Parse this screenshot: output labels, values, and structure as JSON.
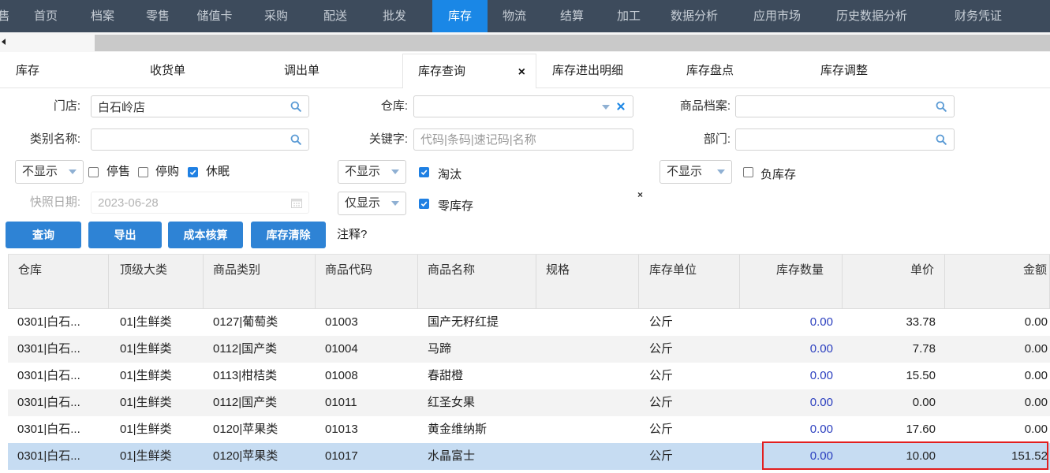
{
  "colors": {
    "nav_bg": "#3d4b5c",
    "nav_text": "#c7ced6",
    "nav_active_bg": "#1a87e6",
    "button_bg": "#2e83d5",
    "selected_row_bg": "#c6dcf2",
    "alt_row_bg": "#f3f3f3",
    "quantity_text": "#2b3fbf",
    "checkbox_checked": "#1f80e3",
    "annotation_box": "#e21f1f",
    "icon": "#5b9bd5"
  },
  "nav": {
    "items": [
      "售",
      "首页",
      "档案",
      "零售",
      "储值卡",
      "采购",
      "配送",
      "批发",
      "库存",
      "物流",
      "结算",
      "加工",
      "数据分析",
      "应用市场",
      "历史数据分析",
      "财务凭证"
    ],
    "active_index": 8
  },
  "tabs": {
    "items": [
      "库存",
      "收货单",
      "调出单",
      "库存查询",
      "库存进出明细",
      "库存盘点",
      "库存调整"
    ],
    "active_index": 3,
    "close_label": "×"
  },
  "filters": {
    "store": {
      "label": "门店:",
      "value": "白石岭店"
    },
    "warehouse": {
      "label": "仓库:"
    },
    "product_archive": {
      "label": "商品档案:"
    },
    "category": {
      "label": "类别名称:"
    },
    "keyword": {
      "label": "关键字:",
      "placeholder": "代码|条码|速记码|名称"
    },
    "department": {
      "label": "部门:"
    },
    "status_display": {
      "value": "不显示"
    },
    "stop_sale": {
      "label": "停售",
      "checked": false
    },
    "stop_purchase": {
      "label": "停购",
      "checked": false
    },
    "dormant": {
      "label": "休眠",
      "checked": true
    },
    "eliminated_display": {
      "value": "不显示"
    },
    "eliminated": {
      "label": "淘汰",
      "checked": true
    },
    "negative_display": {
      "value": "不显示"
    },
    "negative_stock": {
      "label": "负库存",
      "checked": false
    },
    "snapshot_date": {
      "label": "快照日期:",
      "value": "2023-06-28",
      "disabled": true
    },
    "zero_display": {
      "value": "仅显示"
    },
    "zero_stock": {
      "label": "零库存",
      "checked": true
    },
    "close_label": "×"
  },
  "actions": {
    "query": "查询",
    "export": "导出",
    "cost_accounting": "成本核算",
    "clear_stock": "库存清除",
    "note": "注释?"
  },
  "icons": {
    "scroll_left": "caret-left-icon",
    "search": "search-icon",
    "dropdown": "chevron-down-icon",
    "clear": "close-icon",
    "calendar": "calendar-icon",
    "checkbox": "checkbox-icon"
  },
  "table": {
    "columns": [
      "仓库",
      "顶级大类",
      "商品类别",
      "商品代码",
      "商品名称",
      "规格",
      "库存单位",
      "库存数量",
      "单价",
      "金额"
    ],
    "rows": [
      [
        "0301|白石...",
        "01|生鲜类",
        "0127|葡萄类",
        "01003",
        "国产无籽红提",
        "",
        "公斤",
        "0.00",
        "33.78",
        "0.00"
      ],
      [
        "0301|白石...",
        "01|生鲜类",
        "0112|国产类",
        "01004",
        "马蹄",
        "",
        "公斤",
        "0.00",
        "7.78",
        "0.00"
      ],
      [
        "0301|白石...",
        "01|生鲜类",
        "0113|柑桔类",
        "01008",
        "春甜橙",
        "",
        "公斤",
        "0.00",
        "15.50",
        "0.00"
      ],
      [
        "0301|白石...",
        "01|生鲜类",
        "0112|国产类",
        "01011",
        "红圣女果",
        "",
        "公斤",
        "0.00",
        "0.00",
        "0.00"
      ],
      [
        "0301|白石...",
        "01|生鲜类",
        "0120|苹果类",
        "01013",
        "黄金维纳斯",
        "",
        "公斤",
        "0.00",
        "17.60",
        "0.00"
      ],
      [
        "0301|白石...",
        "01|生鲜类",
        "0120|苹果类",
        "01017",
        "水晶富士",
        "",
        "公斤",
        "0.00",
        "10.00",
        "151.52"
      ]
    ],
    "selected_row_index": 5
  }
}
